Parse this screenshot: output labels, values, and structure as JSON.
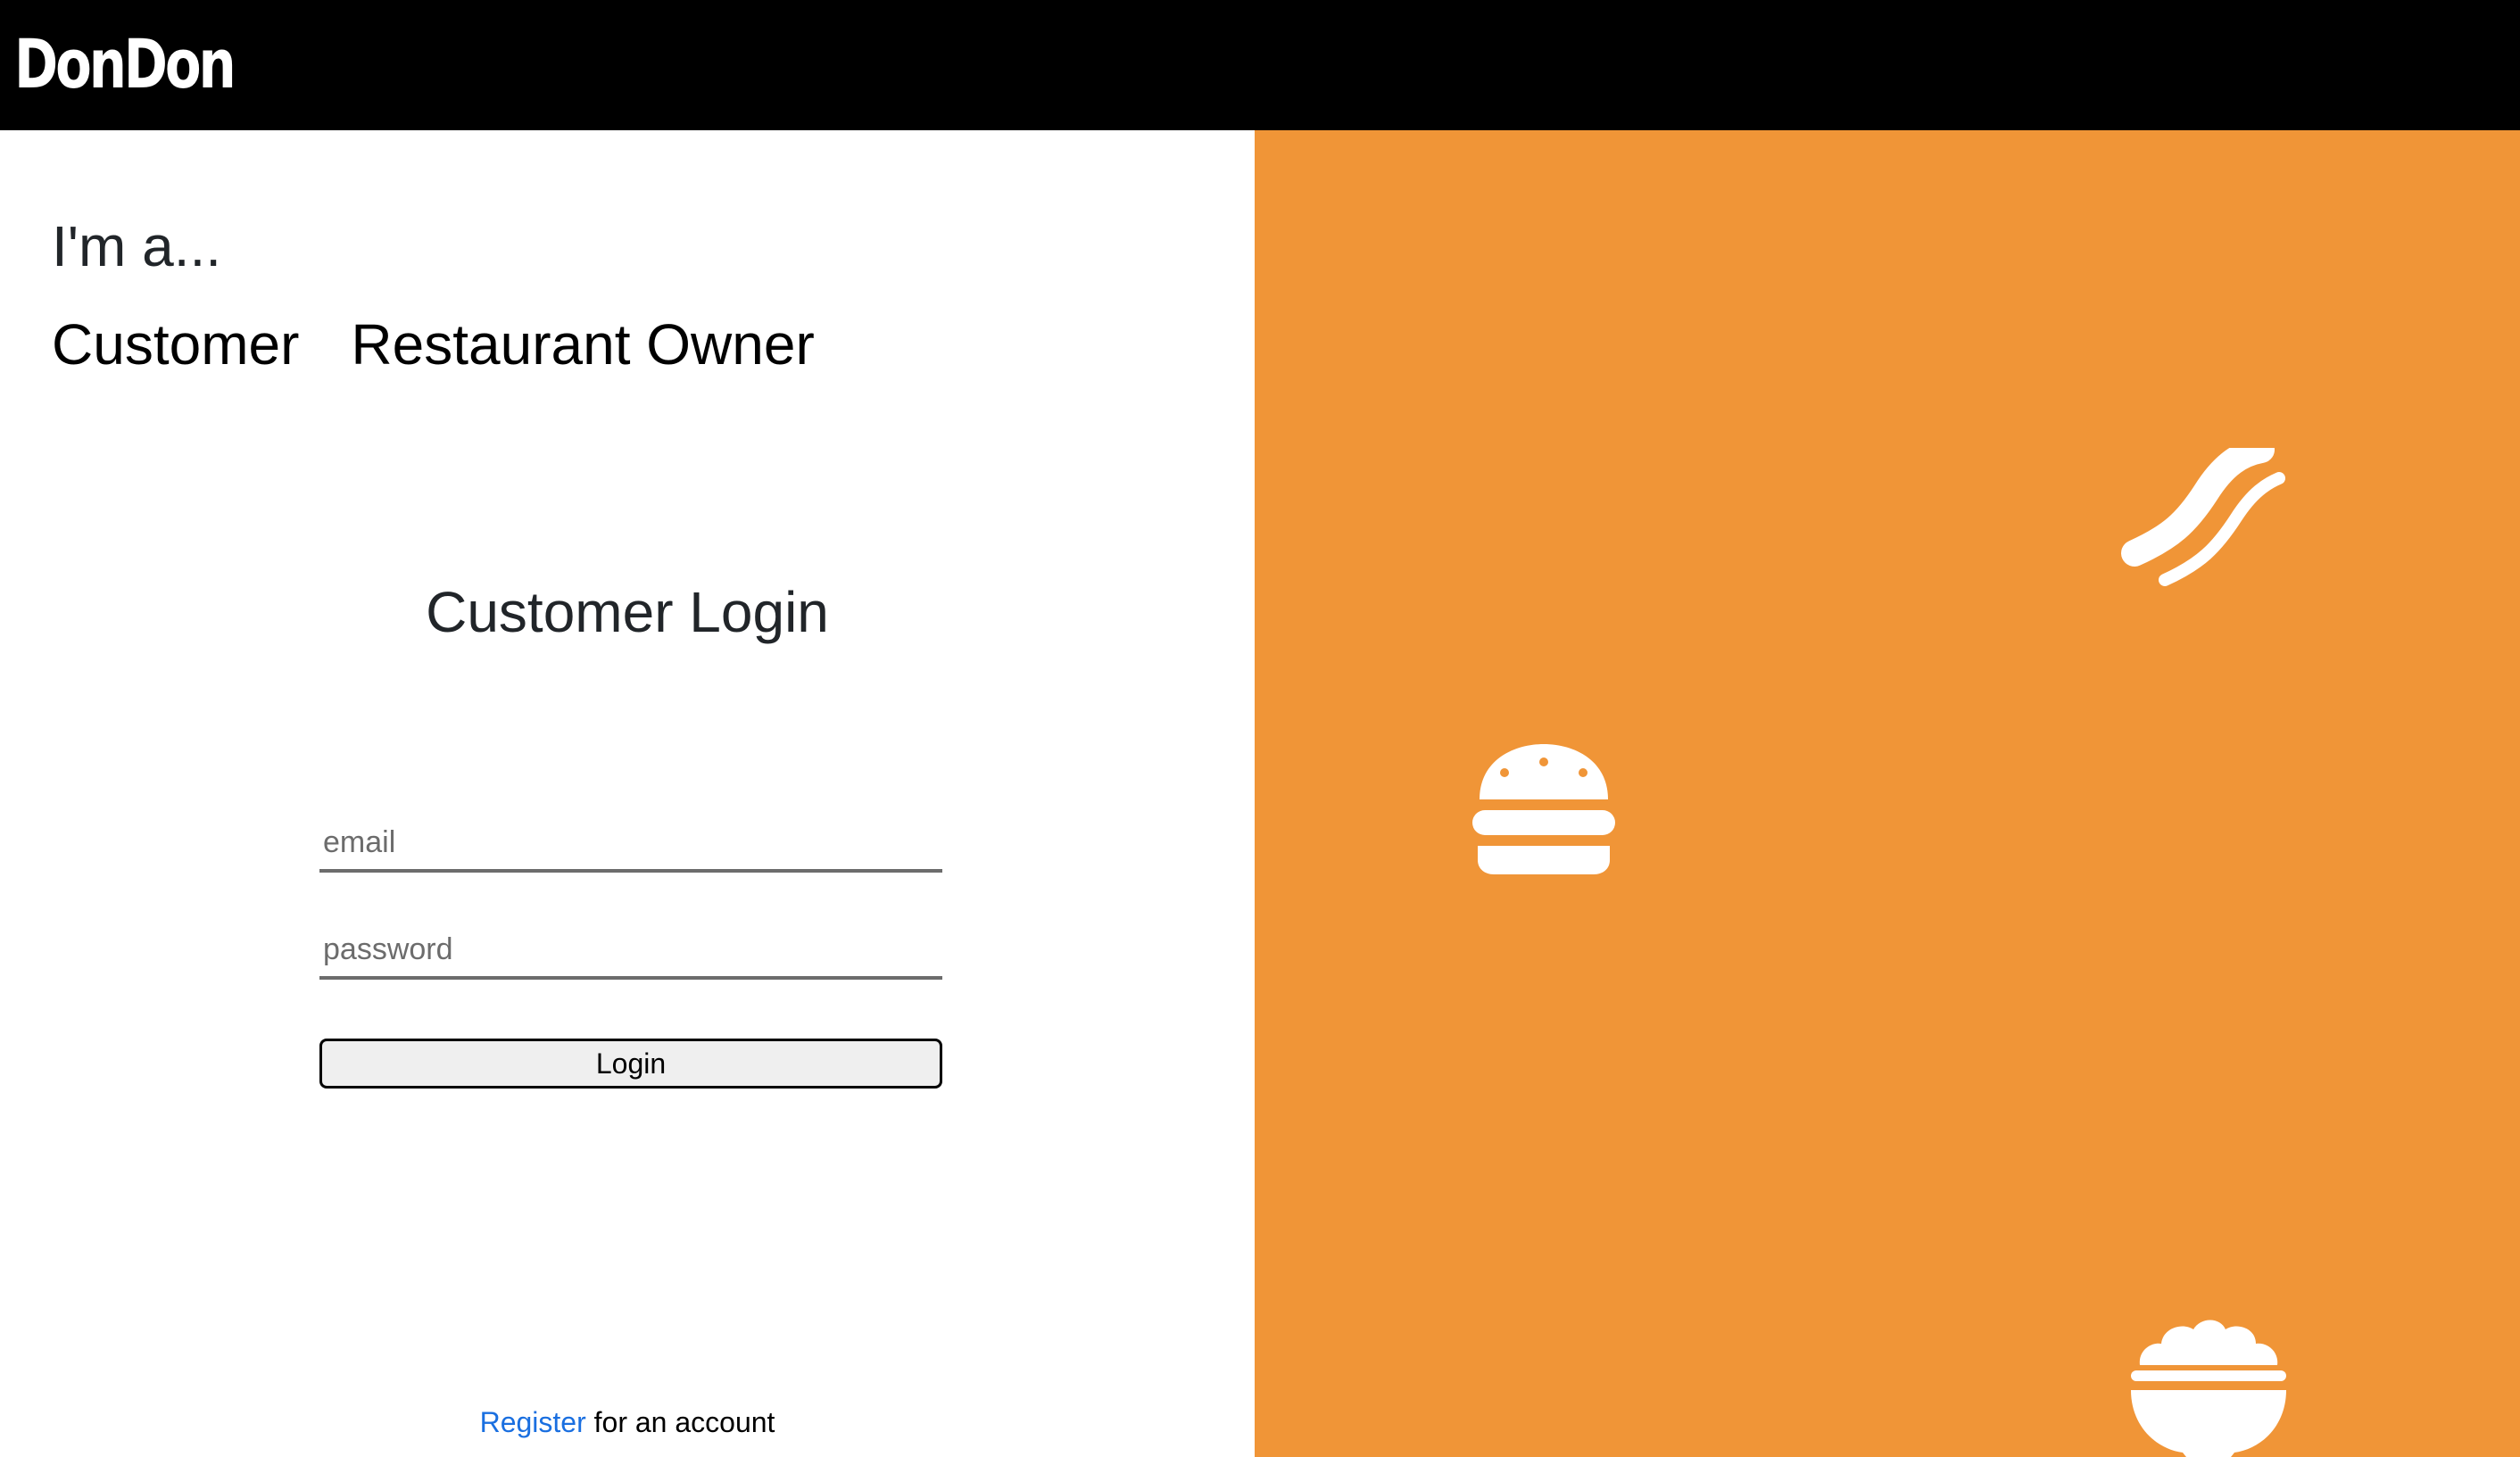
{
  "header": {
    "logo_text": "DonDon"
  },
  "role_selector": {
    "prompt": "I'm a...",
    "options": [
      "Customer",
      "Restaurant Owner"
    ]
  },
  "login_form": {
    "title": "Customer Login",
    "email_placeholder": "email",
    "password_placeholder": "password",
    "submit_label": "Login"
  },
  "register": {
    "link_text": "Register",
    "suffix_text": " for an account"
  },
  "decor": {
    "background_color": "#f09537",
    "icons": [
      "bacon-icon",
      "burger-icon",
      "bowl-icon"
    ]
  }
}
